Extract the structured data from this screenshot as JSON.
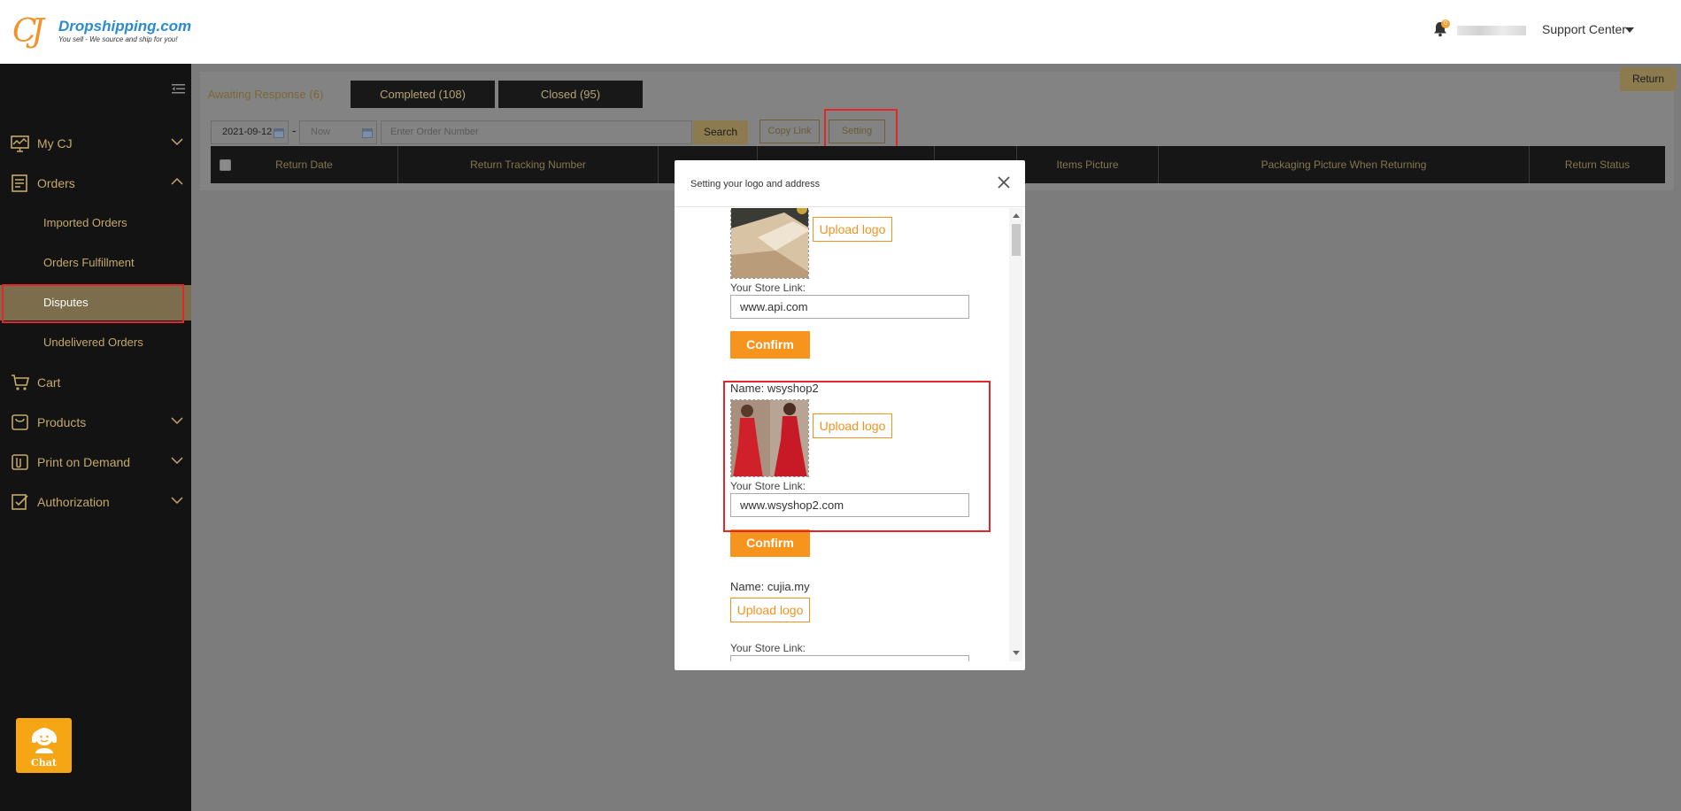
{
  "header": {
    "brand": "Dropshipping.com",
    "tagline": "You sell - We source and ship for you!",
    "notification_count": "0",
    "support_label": "Support Center"
  },
  "sidebar": {
    "items": [
      {
        "label": "My CJ"
      },
      {
        "label": "Orders"
      },
      {
        "label": "Imported Orders"
      },
      {
        "label": "Orders Fulfillment"
      },
      {
        "label": "Disputes"
      },
      {
        "label": "Undelivered Orders"
      },
      {
        "label": "Cart"
      },
      {
        "label": "Products"
      },
      {
        "label": "Print on Demand"
      },
      {
        "label": "Authorization"
      }
    ],
    "chat_label": "Chat"
  },
  "main": {
    "tabs": [
      {
        "label": "Awaiting Response (6)"
      },
      {
        "label": "Completed (108)"
      },
      {
        "label": "Closed (95)"
      }
    ],
    "return_label": "Return",
    "date_from": "2021-09-12",
    "date_to_placeholder": "Now",
    "date_separator": "-",
    "order_placeholder": "Enter Order Number",
    "search_label": "Search",
    "copy_link_label": "Copy Link",
    "setting_label": "Setting",
    "columns": [
      "Return Date",
      "Return Tracking Number",
      "",
      "",
      "",
      "Items Picture",
      "Packaging Picture When Returning",
      "Return Status"
    ]
  },
  "modal": {
    "title": "Setting your logo and address",
    "upload_label": "Upload logo",
    "store_link_label": "Your Store Link:",
    "confirm_label": "Confirm",
    "name_prefix": "Name: ",
    "shops": [
      {
        "name": "",
        "link": "www.api.com"
      },
      {
        "name": "wsyshop2",
        "link": "www.wsyshop2.com"
      },
      {
        "name": "cujia.my",
        "link": ""
      }
    ]
  }
}
